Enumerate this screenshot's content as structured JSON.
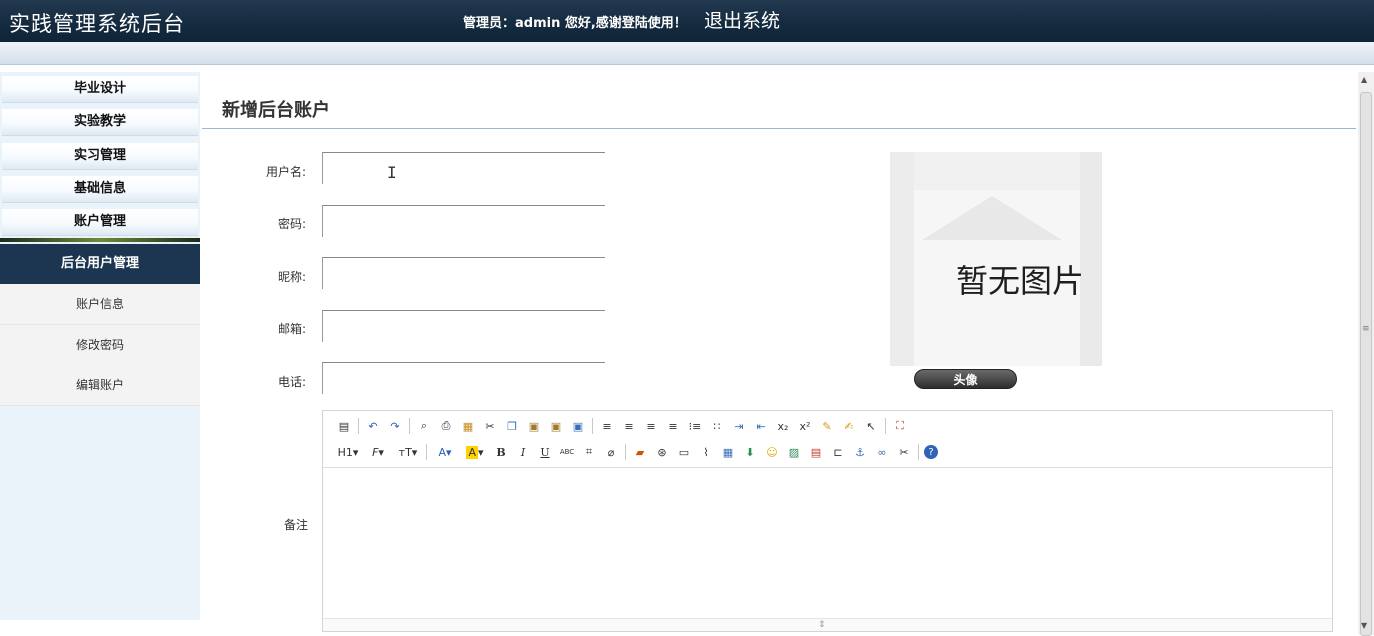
{
  "header": {
    "app_title": "实践管理系统后台",
    "greeting": "管理员：admin 您好,感谢登陆使用！",
    "logout_label": "退出系统"
  },
  "sidebar": {
    "menu_groups": [
      "毕业设计",
      "实验教学",
      "实习管理",
      "基础信息",
      "账户管理"
    ],
    "active_section": "后台用户管理",
    "sub_items": [
      "账户信息",
      "修改密码",
      "编辑账户"
    ]
  },
  "form": {
    "title": "新增后台账户",
    "fields": [
      {
        "label": "用户名:",
        "value": ""
      },
      {
        "label": "密码:",
        "value": ""
      },
      {
        "label": "昵称:",
        "value": ""
      },
      {
        "label": "邮箱:",
        "value": ""
      },
      {
        "label": "电话:",
        "value": ""
      }
    ],
    "notes_label": "备注",
    "avatar": {
      "placeholder_text": "暂无图片",
      "button_label": "头像"
    }
  },
  "editor": {
    "toolbar_row1": [
      "source-icon",
      "undo-icon",
      "redo-icon",
      "preview-icon",
      "print-icon",
      "template-icon",
      "cut-icon",
      "copy-icon",
      "paste-icon",
      "paste-text-icon",
      "paste-word-icon",
      "align-left-icon",
      "align-center-icon",
      "align-right-icon",
      "align-justify-icon",
      "numbered-list-icon",
      "bullet-list-icon",
      "indent-icon",
      "outdent-icon",
      "subscript-icon",
      "superscript-icon",
      "clear-format-icon",
      "select-all-icon",
      "cursor-icon",
      "fullscreen-icon"
    ],
    "toolbar_row2_text": {
      "heading": "H1",
      "font_family": "F",
      "font_size": "тТ",
      "font_color": "A",
      "highlight": "A",
      "bold": "B",
      "italic": "I",
      "underline": "U",
      "strikethrough": "ABC"
    },
    "content": ""
  }
}
